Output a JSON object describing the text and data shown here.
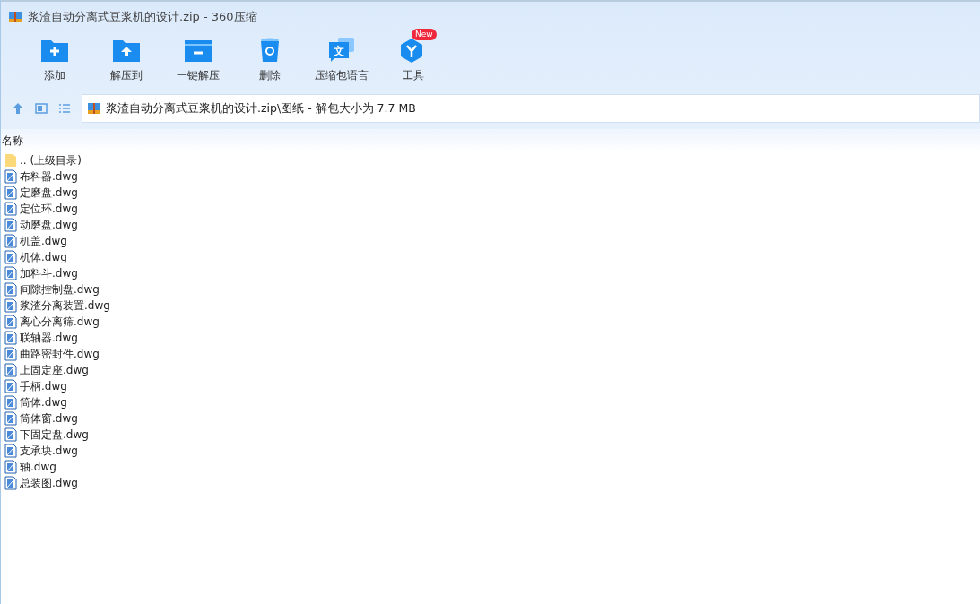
{
  "window": {
    "title": "浆渣自动分离式豆浆机的设计.zip - 360压缩"
  },
  "toolbar": [
    {
      "label": "添加",
      "kind": "add"
    },
    {
      "label": "解压到",
      "kind": "extract"
    },
    {
      "label": "一键解压",
      "kind": "oneclick"
    },
    {
      "label": "删除",
      "kind": "delete"
    },
    {
      "label": "压缩包语言",
      "kind": "language",
      "glyph": "文"
    },
    {
      "label": "工具",
      "kind": "tools",
      "badge": "New"
    }
  ],
  "address": {
    "path": "浆渣自动分离式豆浆机的设计.zip\\图纸 - 解包大小为 7.7 MB"
  },
  "file_list": {
    "columns": [
      "名称"
    ],
    "rows": [
      {
        "name": ".. (上级目录)",
        "kind": "folder"
      },
      {
        "name": "布料器.dwg",
        "kind": "dwg"
      },
      {
        "name": "定磨盘.dwg",
        "kind": "dwg"
      },
      {
        "name": "定位环.dwg",
        "kind": "dwg"
      },
      {
        "name": "动磨盘.dwg",
        "kind": "dwg"
      },
      {
        "name": "机盖.dwg",
        "kind": "dwg"
      },
      {
        "name": "机体.dwg",
        "kind": "dwg"
      },
      {
        "name": "加料斗.dwg",
        "kind": "dwg"
      },
      {
        "name": "间隙控制盘.dwg",
        "kind": "dwg"
      },
      {
        "name": "浆渣分离装置.dwg",
        "kind": "dwg"
      },
      {
        "name": "离心分离筛.dwg",
        "kind": "dwg"
      },
      {
        "name": "联轴器.dwg",
        "kind": "dwg"
      },
      {
        "name": "曲路密封件.dwg",
        "kind": "dwg"
      },
      {
        "name": "上固定座.dwg",
        "kind": "dwg"
      },
      {
        "name": "手柄.dwg",
        "kind": "dwg"
      },
      {
        "name": "筒体.dwg",
        "kind": "dwg"
      },
      {
        "name": "筒体窗.dwg",
        "kind": "dwg"
      },
      {
        "name": "下固定盘.dwg",
        "kind": "dwg"
      },
      {
        "name": "支承块.dwg",
        "kind": "dwg"
      },
      {
        "name": "轴.dwg",
        "kind": "dwg"
      },
      {
        "name": "总装图.dwg",
        "kind": "dwg"
      }
    ]
  }
}
